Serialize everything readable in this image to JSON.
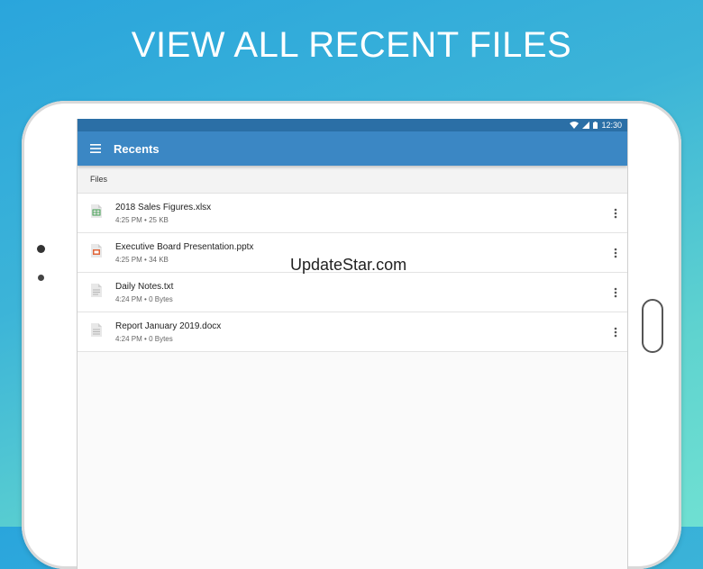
{
  "headline": "VIEW ALL RECENT FILES",
  "watermark": "UpdateStar.com",
  "status_bar": {
    "time": "12:30"
  },
  "app_bar": {
    "title": "Recents",
    "menu_icon": "hamburger-menu-icon"
  },
  "section": {
    "label": "Files"
  },
  "files": [
    {
      "name": "2018 Sales Figures.xlsx",
      "time": "4:25 PM",
      "size": "25 KB",
      "icon": "spreadsheet-file-icon",
      "color": "#3f9e4f"
    },
    {
      "name": "Executive Board Presentation.pptx",
      "time": "4:25 PM",
      "size": "34 KB",
      "icon": "presentation-file-icon",
      "color": "#e0663a"
    },
    {
      "name": "Daily Notes.txt",
      "time": "4:24 PM",
      "size": "0 Bytes",
      "icon": "text-file-icon",
      "color": "#9e9e9e"
    },
    {
      "name": "Report January 2019.docx",
      "time": "4:24 PM",
      "size": "0 Bytes",
      "icon": "document-file-icon",
      "color": "#9e9e9e"
    }
  ],
  "colors": {
    "app_bar": "#3b87c4",
    "status_bar": "#2b6fa6"
  },
  "meta_separator": "•"
}
